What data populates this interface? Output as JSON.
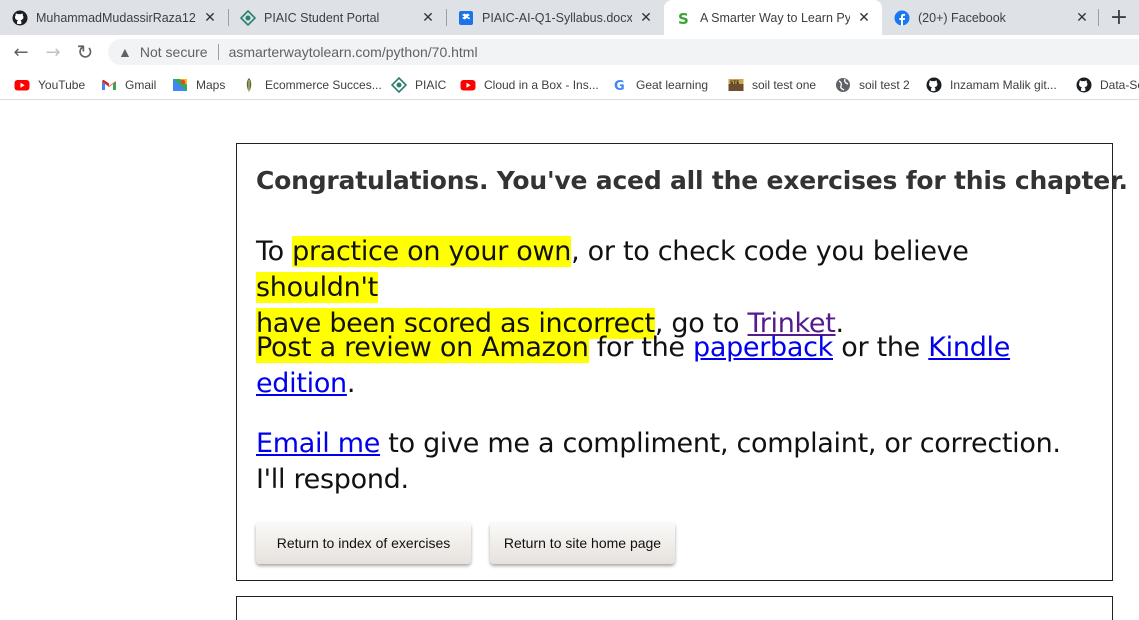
{
  "tabs": [
    {
      "title": "MuhammadMudassirRaza12",
      "favicon": "github-icon",
      "close": "✕"
    },
    {
      "title": "PIAIC Student Portal",
      "favicon": "piaic-icon",
      "close": "✕"
    },
    {
      "title": "PIAIC-AI-Q1-Syllabus.docx",
      "favicon": "dropbox-icon",
      "close": "✕"
    },
    {
      "title": "A Smarter Way to Learn Pyth",
      "favicon": "smarterway-icon",
      "close": "✕"
    },
    {
      "title": "(20+) Facebook",
      "favicon": "facebook-icon",
      "close": "✕"
    }
  ],
  "new_tab_label": "+",
  "toolbar": {
    "back": "←",
    "forward": "→",
    "reload": "↻",
    "security_icon": "▲",
    "security_text": "Not secure",
    "url": "asmarterwaytolearn.com/python/70.html"
  },
  "bookmarks": [
    {
      "label": "YouTube",
      "icon": "youtube-icon"
    },
    {
      "label": "Gmail",
      "icon": "gmail-icon"
    },
    {
      "label": "Maps",
      "icon": "maps-icon"
    },
    {
      "label": "Ecommerce Succes...",
      "icon": "ecommerce-icon"
    },
    {
      "label": "PIAIC",
      "icon": "piaic-icon"
    },
    {
      "label": "Cloud in a Box - Ins...",
      "icon": "youtube-icon"
    },
    {
      "label": "Geat learning",
      "icon": "google-icon"
    },
    {
      "label": "soil test one",
      "icon": "soiltest-icon"
    },
    {
      "label": "soil test 2",
      "icon": "globe-icon"
    },
    {
      "label": "Inzamam Malik git...",
      "icon": "github-icon"
    },
    {
      "label": "Data-Sc",
      "icon": "github-icon"
    }
  ],
  "content": {
    "heading": "Congratulations. You've aced all the exercises for this chapter.",
    "p1": {
      "a": "To ",
      "hl1": "practice on your own",
      "b": ", or to check code you believe ",
      "hl2a": "shouldn't",
      "hl2b": "have been scored as incorrect",
      "c": ", go to ",
      "link": "Trinket",
      "d": "."
    },
    "p2": {
      "hl": "Post a review on Amazon",
      "a": " for the ",
      "link1": "paperback",
      "b": " or the ",
      "link2": "Kindle edition",
      "c": "."
    },
    "p3": {
      "link": "Email me",
      "a": " to give me a compliment, complaint, or correction. I'll respond."
    },
    "buttons": {
      "index": "Return to index of exercises",
      "home": "Return to site home page"
    }
  },
  "colors": {
    "highlight": "#ffff00",
    "link": "#0000ee",
    "visited_link": "#551a8b",
    "tabstrip": "#dee1e6"
  }
}
